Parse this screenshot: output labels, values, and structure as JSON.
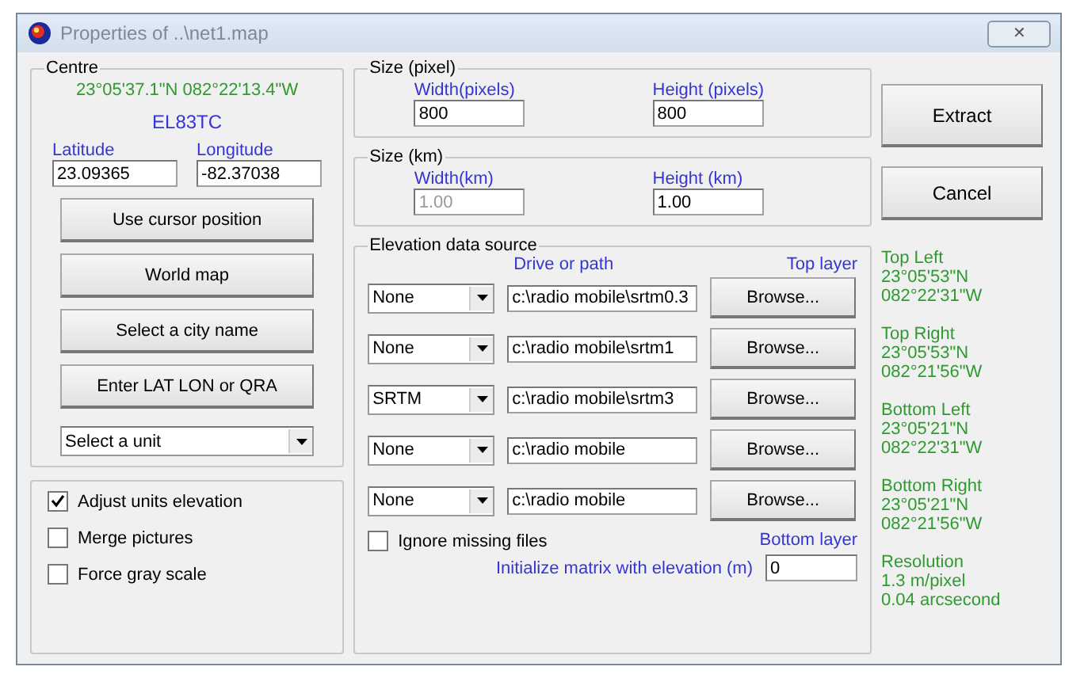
{
  "window": {
    "title": "Properties of ..\\net1.map",
    "close": "✕"
  },
  "centre": {
    "legend": "Centre",
    "coords": "23°05'37.1\"N 082°22'13.4\"W",
    "locator": "EL83TC",
    "latitude": {
      "label": "Latitude",
      "value": "23.09365"
    },
    "longitude": {
      "label": "Longitude",
      "value": "-82.37038"
    },
    "buttons": [
      "Use cursor position",
      "World map",
      "Select a city name",
      "Enter LAT LON or QRA"
    ],
    "unit_select": {
      "value": "Select a unit"
    }
  },
  "options": [
    {
      "label": "Adjust units elevation",
      "checked": true
    },
    {
      "label": "Merge pictures",
      "checked": false
    },
    {
      "label": "Force gray scale",
      "checked": false
    }
  ],
  "size_pixel": {
    "legend": "Size (pixel)",
    "width": {
      "label": "Width(pixels)",
      "value": "800",
      "disabled": false
    },
    "height": {
      "label": "Height (pixels)",
      "value": "800",
      "disabled": false
    }
  },
  "size_km": {
    "legend": "Size (km)",
    "width": {
      "label": "Width(km)",
      "value": "1.00",
      "disabled": true
    },
    "height": {
      "label": "Height (km)",
      "value": "1.00",
      "disabled": false
    }
  },
  "elevation": {
    "legend": "Elevation data source",
    "path_header": "Drive or path",
    "top_label": "Top layer",
    "bottom_label": "Bottom layer",
    "rows": [
      {
        "source": "None",
        "path": "c:\\radio mobile\\srtm0.3",
        "button": "Browse..."
      },
      {
        "source": "None",
        "path": "c:\\radio mobile\\srtm1",
        "button": "Browse..."
      },
      {
        "source": "SRTM",
        "path": "c:\\radio mobile\\srtm3",
        "button": "Browse..."
      },
      {
        "source": "None",
        "path": "c:\\radio mobile",
        "button": "Browse..."
      },
      {
        "source": "None",
        "path": "c:\\radio mobile",
        "button": "Browse..."
      }
    ],
    "ignore_missing": {
      "label": "Ignore missing files",
      "checked": false
    },
    "init_matrix": {
      "label": "Initialize matrix with elevation (m)",
      "value": "0"
    }
  },
  "actions": [
    "Extract",
    "Cancel"
  ],
  "info": [
    {
      "title": "Top Left",
      "lines": [
        "23°05'53\"N",
        "082°22'31\"W"
      ]
    },
    {
      "title": "Top Right",
      "lines": [
        "23°05'53\"N",
        "082°21'56\"W"
      ]
    },
    {
      "title": "Bottom Left",
      "lines": [
        "23°05'21\"N",
        "082°22'31\"W"
      ]
    },
    {
      "title": "Bottom Right",
      "lines": [
        "23°05'21\"N",
        "082°21'56\"W"
      ]
    },
    {
      "title": "Resolution",
      "lines": [
        "1.3 m/pixel",
        "0.04 arcsecond"
      ]
    }
  ]
}
